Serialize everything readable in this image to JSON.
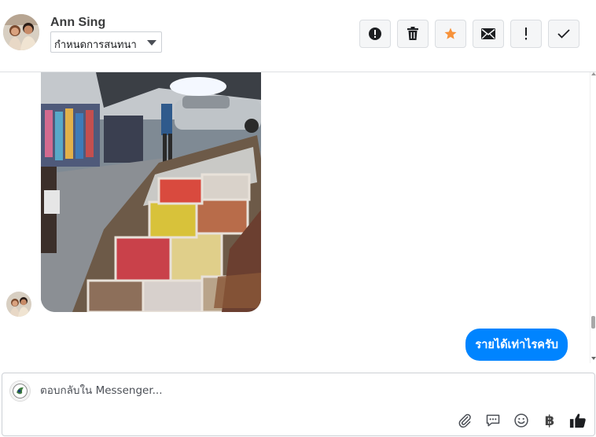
{
  "header": {
    "contact_name": "Ann Sing",
    "conversation_select": {
      "selected": "กำหนดการสนทนา"
    },
    "actions": [
      {
        "name": "report-spam-icon"
      },
      {
        "name": "delete-icon"
      },
      {
        "name": "star-icon",
        "color": "#f7923a"
      },
      {
        "name": "mark-unread-icon"
      },
      {
        "name": "follow-up-icon"
      },
      {
        "name": "mark-done-icon"
      }
    ]
  },
  "thread": {
    "messages": [
      {
        "type": "image",
        "from": "contact",
        "alt_icon": "market-stall-photo"
      },
      {
        "type": "text",
        "from": "page",
        "text": "รายได้เท่าไรครับ",
        "color": "#0084ff"
      }
    ]
  },
  "composer": {
    "placeholder": "ตอบกลับใน Messenger...",
    "tools": [
      "attachment-icon",
      "saved-replies-icon",
      "emoji-icon",
      "payment-icon",
      "like-icon"
    ],
    "payment_symbol": "฿"
  }
}
